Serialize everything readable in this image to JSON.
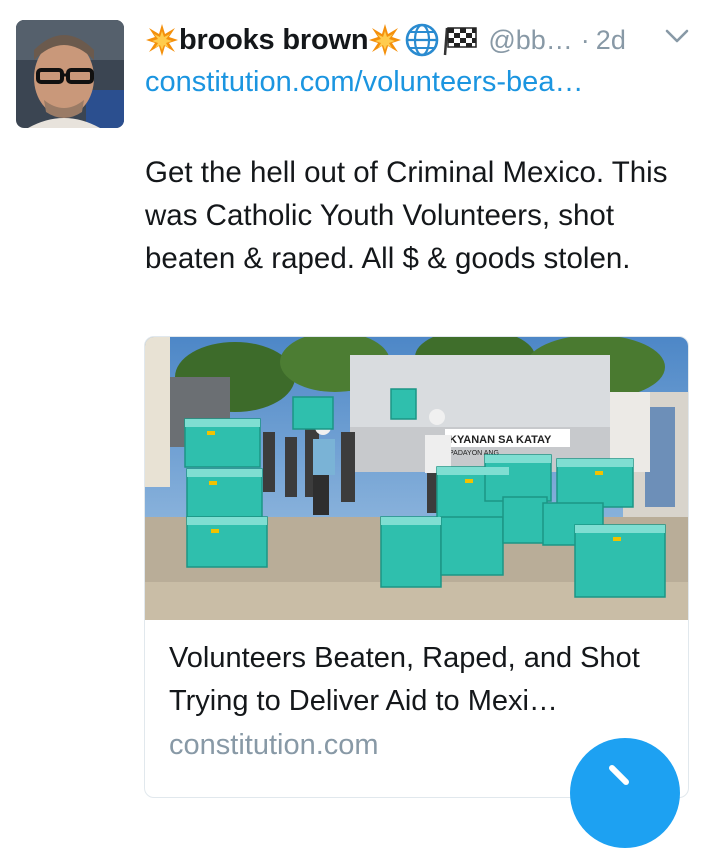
{
  "tweet": {
    "user": {
      "name": "brooks brown",
      "handle": "@bb…",
      "time": "2d"
    },
    "link_text": "constitution.com/volunteers-bea…",
    "text": "Get the hell out of Criminal Mexico. This was Catholic Youth Volunteers, shot beaten & raped. All $ & goods stolen.",
    "card": {
      "image_sign_text": "KYANAN SA KATAY",
      "image_sign_subtext": "PADAYON ANG",
      "title": "Volunteers Beaten, Raped, and Shot Trying to Deliver Aid to Mexi…",
      "domain": "constitution.com"
    }
  },
  "colors": {
    "link": "#1b95e0",
    "secondary_text": "#8899a6",
    "primary_text": "#14171a",
    "fab": "#1da1f2",
    "box_teal": "#2fbfad"
  },
  "icons": [
    "collision-emoji",
    "globe-emoji",
    "checkered-flag-emoji",
    "chevron-down-icon",
    "compose-fab"
  ]
}
